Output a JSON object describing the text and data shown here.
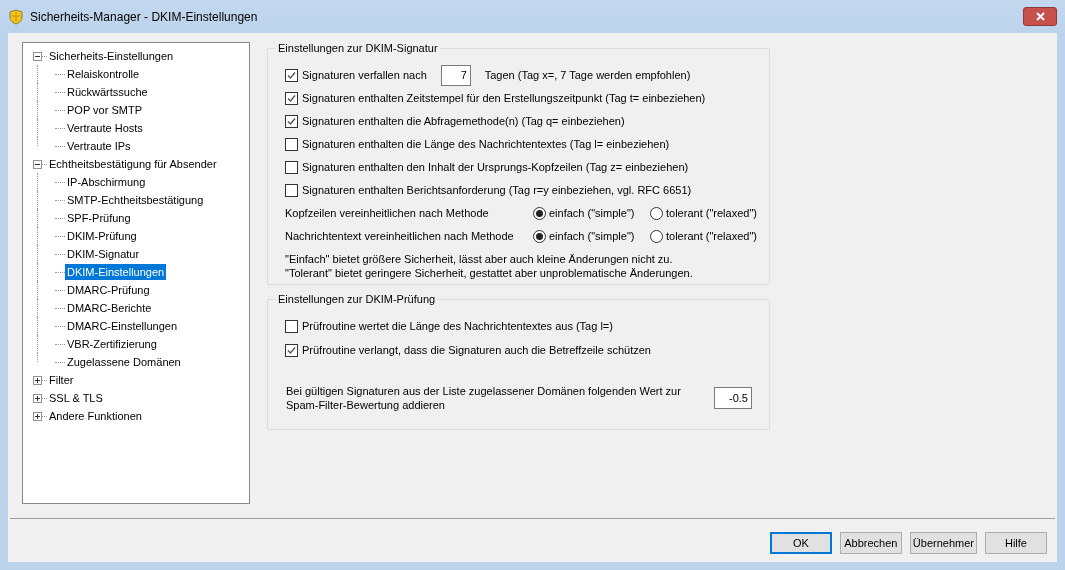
{
  "window": {
    "title": "Sicherheits-Manager - DKIM-Einstellungen"
  },
  "tree": [
    {
      "label": "Sicherheits-Einstellungen",
      "expanded": true,
      "selected": false,
      "children": [
        {
          "label": "Relaiskontrolle",
          "selected": false
        },
        {
          "label": "Rückwärtssuche",
          "selected": false
        },
        {
          "label": "POP vor SMTP",
          "selected": false
        },
        {
          "label": "Vertraute Hosts",
          "selected": false
        },
        {
          "label": "Vertraute IPs",
          "selected": false
        }
      ]
    },
    {
      "label": "Echtheitsbestätigung für Absender",
      "expanded": true,
      "selected": false,
      "children": [
        {
          "label": "IP-Abschirmung",
          "selected": false
        },
        {
          "label": "SMTP-Echtheitsbestätigung",
          "selected": false
        },
        {
          "label": "SPF-Prüfung",
          "selected": false
        },
        {
          "label": "DKIM-Prüfung",
          "selected": false
        },
        {
          "label": "DKIM-Signatur",
          "selected": false
        },
        {
          "label": "DKIM-Einstellungen",
          "selected": true
        },
        {
          "label": "DMARC-Prüfung",
          "selected": false
        },
        {
          "label": "DMARC-Berichte",
          "selected": false
        },
        {
          "label": "DMARC-Einstellungen",
          "selected": false
        },
        {
          "label": "VBR-Zertifizierung",
          "selected": false
        },
        {
          "label": "Zugelassene Domänen",
          "selected": false
        }
      ]
    },
    {
      "label": "Filter",
      "expanded": false,
      "selected": false
    },
    {
      "label": "SSL & TLS",
      "expanded": false,
      "selected": false
    },
    {
      "label": "Andere Funktionen",
      "expanded": false,
      "selected": false
    }
  ],
  "signing": {
    "title": "Einstellungen zur DKIM-Signatur",
    "checkboxes": [
      {
        "label": "Signaturen verfallen nach",
        "checked": true,
        "value": "7",
        "suffix": "Tagen (Tag x=, 7 Tage werden empfohlen)"
      },
      {
        "label": "Signaturen enthalten Zeitstempel für den Erstellungszeitpunkt (Tag t= einbeziehen)",
        "checked": true
      },
      {
        "label": "Signaturen enthalten die Abfragemethode(n) (Tag q= einbeziehen)",
        "checked": true
      },
      {
        "label": "Signaturen enthalten die Länge des Nachrichtentextes (Tag l= einbeziehen)",
        "checked": false
      },
      {
        "label": "Signaturen enthalten den Inhalt der Ursprungs-Kopfzeilen (Tag z= einbeziehen)",
        "checked": false
      },
      {
        "label": "Signaturen enthalten Berichtsanforderung (Tag r=y einbeziehen, vgl. RFC 6651)",
        "checked": false
      }
    ],
    "radio_rows": [
      {
        "label": "Kopfzeilen vereinheitlichen nach Methode",
        "options": [
          {
            "label": "einfach (\"simple\")",
            "selected": true
          },
          {
            "label": "tolerant (\"relaxed\")",
            "selected": false
          }
        ]
      },
      {
        "label": "Nachrichtentext vereinheitlichen nach Methode",
        "options": [
          {
            "label": "einfach (\"simple\")",
            "selected": true
          },
          {
            "label": "tolerant (\"relaxed\")",
            "selected": false
          }
        ]
      }
    ],
    "note": [
      "\"Einfach\" bietet größere Sicherheit, lässt aber auch kleine Änderungen nicht zu.",
      "\"Tolerant\" bietet geringere Sicherheit, gestattet aber unproblematische Änderungen."
    ]
  },
  "verification": {
    "title": "Einstellungen zur DKIM-Prüfung",
    "checkboxes": [
      {
        "label": "Prüfroutine wertet die Länge des Nachrichtentextes aus (Tag l=)",
        "checked": false
      },
      {
        "label": "Prüfroutine verlangt, dass die Signaturen auch die Betreffzeile schützen",
        "checked": true
      }
    ],
    "score_label": "Bei gültigen Signaturen aus der Liste zugelassener Domänen folgenden Wert zur Spam-Filter-Bewertung addieren",
    "score_value": "-0.5"
  },
  "buttons": [
    {
      "label": "OK",
      "default": true
    },
    {
      "label": "Abbrechen",
      "default": false
    },
    {
      "label": "Übernehmer",
      "default": false
    },
    {
      "label": "Hilfe",
      "default": false
    }
  ]
}
